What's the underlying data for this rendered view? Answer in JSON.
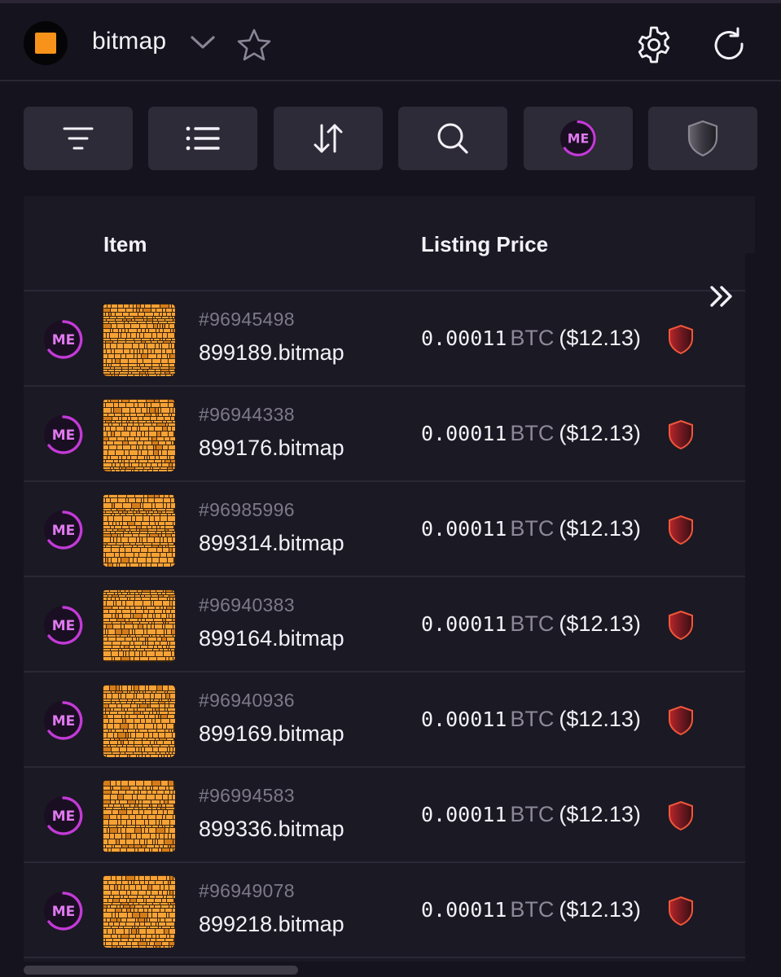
{
  "header": {
    "collection_name": "bitmap",
    "icons": [
      "collection-logo",
      "chevron-down-icon",
      "star-icon",
      "gear-icon",
      "refresh-icon"
    ],
    "accent": "#f7931a"
  },
  "toolbar": {
    "buttons": [
      "filter-icon",
      "list-icon",
      "sort-icon",
      "search-icon",
      "magic-eden-icon",
      "shield-icon"
    ]
  },
  "table": {
    "columns": {
      "item": "Item",
      "price": "Listing Price"
    },
    "rows": [
      {
        "inscription": "#96945498",
        "name": "899189.bitmap",
        "amount": "0.00011",
        "currency": "BTC",
        "usd": "($12.13)"
      },
      {
        "inscription": "#96944338",
        "name": "899176.bitmap",
        "amount": "0.00011",
        "currency": "BTC",
        "usd": "($12.13)"
      },
      {
        "inscription": "#96985996",
        "name": "899314.bitmap",
        "amount": "0.00011",
        "currency": "BTC",
        "usd": "($12.13)"
      },
      {
        "inscription": "#96940383",
        "name": "899164.bitmap",
        "amount": "0.00011",
        "currency": "BTC",
        "usd": "($12.13)"
      },
      {
        "inscription": "#96940936",
        "name": "899169.bitmap",
        "amount": "0.00011",
        "currency": "BTC",
        "usd": "($12.13)"
      },
      {
        "inscription": "#96994583",
        "name": "899336.bitmap",
        "amount": "0.00011",
        "currency": "BTC",
        "usd": "($12.13)"
      },
      {
        "inscription": "#96949078",
        "name": "899218.bitmap",
        "amount": "0.00011",
        "currency": "BTC",
        "usd": "($12.13)"
      }
    ]
  },
  "colors": {
    "background": "#15131d",
    "panel": "#1b1924",
    "button": "#2e2b38",
    "muted_text": "#7e7989",
    "marketplace_purple": "#c23bd6",
    "shield_red": "#e0452b"
  }
}
